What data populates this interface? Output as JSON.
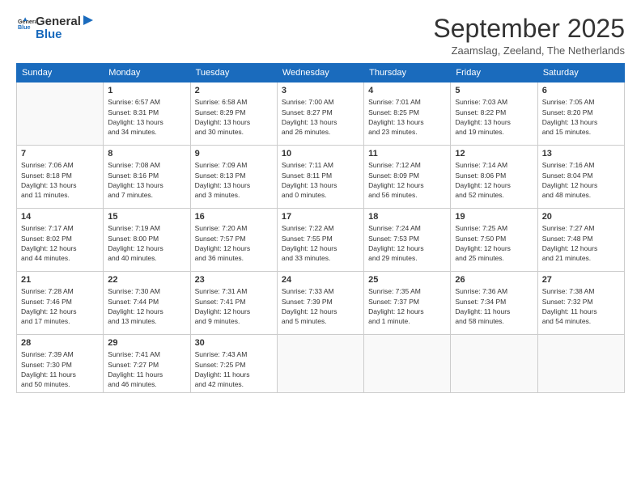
{
  "logo": {
    "general": "General",
    "blue": "Blue"
  },
  "title": "September 2025",
  "subtitle": "Zaamslag, Zeeland, The Netherlands",
  "weekdays": [
    "Sunday",
    "Monday",
    "Tuesday",
    "Wednesday",
    "Thursday",
    "Friday",
    "Saturday"
  ],
  "weeks": [
    [
      {
        "day": "",
        "info": ""
      },
      {
        "day": "1",
        "info": "Sunrise: 6:57 AM\nSunset: 8:31 PM\nDaylight: 13 hours\nand 34 minutes."
      },
      {
        "day": "2",
        "info": "Sunrise: 6:58 AM\nSunset: 8:29 PM\nDaylight: 13 hours\nand 30 minutes."
      },
      {
        "day": "3",
        "info": "Sunrise: 7:00 AM\nSunset: 8:27 PM\nDaylight: 13 hours\nand 26 minutes."
      },
      {
        "day": "4",
        "info": "Sunrise: 7:01 AM\nSunset: 8:25 PM\nDaylight: 13 hours\nand 23 minutes."
      },
      {
        "day": "5",
        "info": "Sunrise: 7:03 AM\nSunset: 8:22 PM\nDaylight: 13 hours\nand 19 minutes."
      },
      {
        "day": "6",
        "info": "Sunrise: 7:05 AM\nSunset: 8:20 PM\nDaylight: 13 hours\nand 15 minutes."
      }
    ],
    [
      {
        "day": "7",
        "info": "Sunrise: 7:06 AM\nSunset: 8:18 PM\nDaylight: 13 hours\nand 11 minutes."
      },
      {
        "day": "8",
        "info": "Sunrise: 7:08 AM\nSunset: 8:16 PM\nDaylight: 13 hours\nand 7 minutes."
      },
      {
        "day": "9",
        "info": "Sunrise: 7:09 AM\nSunset: 8:13 PM\nDaylight: 13 hours\nand 3 minutes."
      },
      {
        "day": "10",
        "info": "Sunrise: 7:11 AM\nSunset: 8:11 PM\nDaylight: 13 hours\nand 0 minutes."
      },
      {
        "day": "11",
        "info": "Sunrise: 7:12 AM\nSunset: 8:09 PM\nDaylight: 12 hours\nand 56 minutes."
      },
      {
        "day": "12",
        "info": "Sunrise: 7:14 AM\nSunset: 8:06 PM\nDaylight: 12 hours\nand 52 minutes."
      },
      {
        "day": "13",
        "info": "Sunrise: 7:16 AM\nSunset: 8:04 PM\nDaylight: 12 hours\nand 48 minutes."
      }
    ],
    [
      {
        "day": "14",
        "info": "Sunrise: 7:17 AM\nSunset: 8:02 PM\nDaylight: 12 hours\nand 44 minutes."
      },
      {
        "day": "15",
        "info": "Sunrise: 7:19 AM\nSunset: 8:00 PM\nDaylight: 12 hours\nand 40 minutes."
      },
      {
        "day": "16",
        "info": "Sunrise: 7:20 AM\nSunset: 7:57 PM\nDaylight: 12 hours\nand 36 minutes."
      },
      {
        "day": "17",
        "info": "Sunrise: 7:22 AM\nSunset: 7:55 PM\nDaylight: 12 hours\nand 33 minutes."
      },
      {
        "day": "18",
        "info": "Sunrise: 7:24 AM\nSunset: 7:53 PM\nDaylight: 12 hours\nand 29 minutes."
      },
      {
        "day": "19",
        "info": "Sunrise: 7:25 AM\nSunset: 7:50 PM\nDaylight: 12 hours\nand 25 minutes."
      },
      {
        "day": "20",
        "info": "Sunrise: 7:27 AM\nSunset: 7:48 PM\nDaylight: 12 hours\nand 21 minutes."
      }
    ],
    [
      {
        "day": "21",
        "info": "Sunrise: 7:28 AM\nSunset: 7:46 PM\nDaylight: 12 hours\nand 17 minutes."
      },
      {
        "day": "22",
        "info": "Sunrise: 7:30 AM\nSunset: 7:44 PM\nDaylight: 12 hours\nand 13 minutes."
      },
      {
        "day": "23",
        "info": "Sunrise: 7:31 AM\nSunset: 7:41 PM\nDaylight: 12 hours\nand 9 minutes."
      },
      {
        "day": "24",
        "info": "Sunrise: 7:33 AM\nSunset: 7:39 PM\nDaylight: 12 hours\nand 5 minutes."
      },
      {
        "day": "25",
        "info": "Sunrise: 7:35 AM\nSunset: 7:37 PM\nDaylight: 12 hours\nand 1 minute."
      },
      {
        "day": "26",
        "info": "Sunrise: 7:36 AM\nSunset: 7:34 PM\nDaylight: 11 hours\nand 58 minutes."
      },
      {
        "day": "27",
        "info": "Sunrise: 7:38 AM\nSunset: 7:32 PM\nDaylight: 11 hours\nand 54 minutes."
      }
    ],
    [
      {
        "day": "28",
        "info": "Sunrise: 7:39 AM\nSunset: 7:30 PM\nDaylight: 11 hours\nand 50 minutes."
      },
      {
        "day": "29",
        "info": "Sunrise: 7:41 AM\nSunset: 7:27 PM\nDaylight: 11 hours\nand 46 minutes."
      },
      {
        "day": "30",
        "info": "Sunrise: 7:43 AM\nSunset: 7:25 PM\nDaylight: 11 hours\nand 42 minutes."
      },
      {
        "day": "",
        "info": ""
      },
      {
        "day": "",
        "info": ""
      },
      {
        "day": "",
        "info": ""
      },
      {
        "day": "",
        "info": ""
      }
    ]
  ]
}
